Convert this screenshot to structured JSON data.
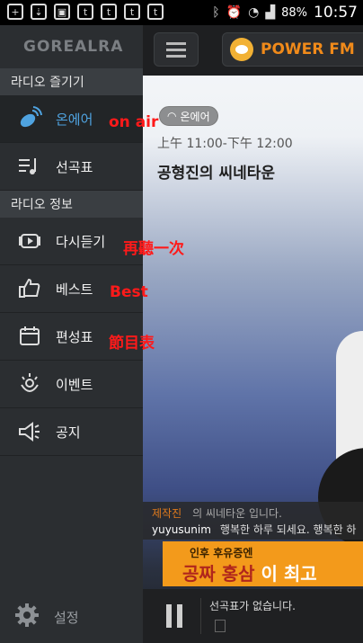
{
  "status_bar": {
    "battery": "88%",
    "time": "10:57"
  },
  "drawer": {
    "logo": "GOREALRA",
    "section_listen": "라디오 즐기기",
    "section_info": "라디오 정보",
    "items": [
      {
        "label": "온에어",
        "icon": "on-air-satellite-icon"
      },
      {
        "label": "선곡표",
        "icon": "music-playlist-icon"
      },
      {
        "label": "다시듣기",
        "icon": "replay-icon"
      },
      {
        "label": "베스트",
        "icon": "thumbs-up-icon"
      },
      {
        "label": "편성표",
        "icon": "calendar-icon"
      },
      {
        "label": "이벤트",
        "icon": "event-icon"
      },
      {
        "label": "공지",
        "icon": "megaphone-icon"
      }
    ],
    "settings_label": "설정"
  },
  "annotations": {
    "on_air": "on air",
    "replay": "再聽一次",
    "best": "Best",
    "schedule": "節目表"
  },
  "content": {
    "channel_label": "POWER FM",
    "onair_badge": "온에어",
    "time_range": "上午 11:00-下午 12:00",
    "program_title": "공형진의 씨네타운",
    "ticker_producer": "제작진",
    "ticker_line1": "의 씨네타운 입니다.",
    "ticker_user": "yuyusunim",
    "ticker_line2": "행복한 하루 되세요.  행복한 하",
    "banner_line1": "인후 후유증엔",
    "banner_line2a": "공짜 홍삼",
    "banner_line2b": "이 최고",
    "player_empty": "선곡표가 없습니다."
  },
  "colors": {
    "drawer_bg": "#2b2e31",
    "active_label": "#4fa3e0",
    "channel_orange": "#f08a1a",
    "annotation_red": "#ff1a1a"
  }
}
